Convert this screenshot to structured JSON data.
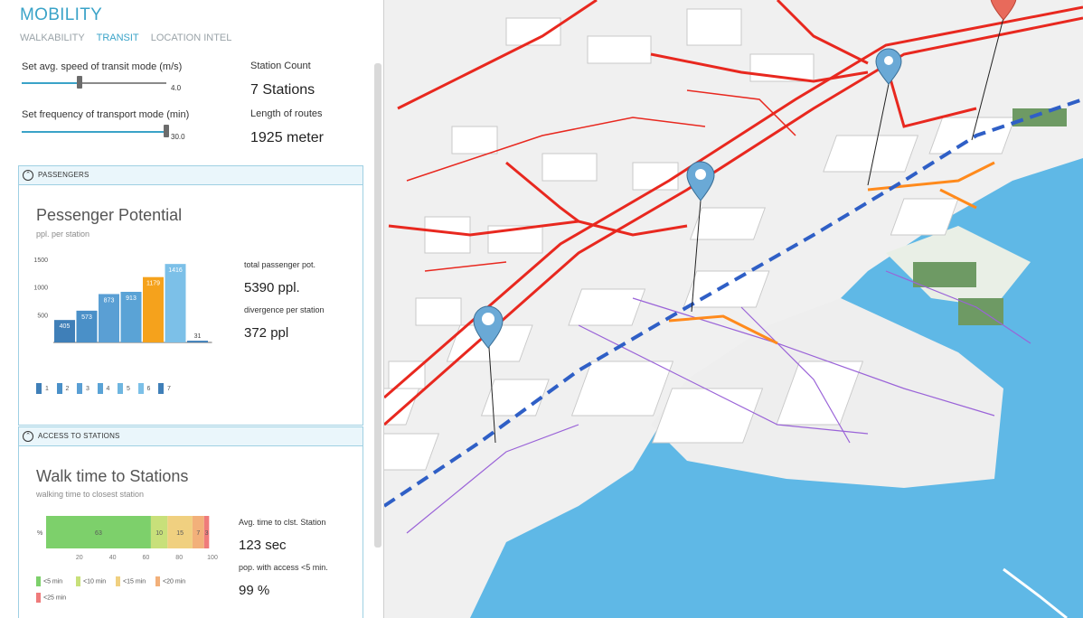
{
  "app": {
    "title": "MOBILITY"
  },
  "tabs": [
    {
      "label": "WALKABILITY",
      "active": false
    },
    {
      "label": "TRANSIT",
      "active": true
    },
    {
      "label": "LOCATION INTEL",
      "active": false
    }
  ],
  "controls": {
    "speed_label": "Set avg. speed of transit mode (m/s)",
    "speed_value": "4.0",
    "speed_fraction": 0.4,
    "frequency_label": "Set frequency of transport mode (min)",
    "frequency_value": "30.0",
    "frequency_fraction": 1.0
  },
  "stats": {
    "station_count_label": "Station Count",
    "station_count_value": "7 Stations",
    "length_label": "Length of routes",
    "length_value": "1925 meter"
  },
  "passengers": {
    "header": "PASSENGERS",
    "title": "Pessenger Potential",
    "subtitle": "ppl. per station",
    "total_label": "total passenger pot.",
    "total_value": "5390 ppl.",
    "divergence_label": "divergence per station",
    "divergence_value": "372 ppl",
    "legend": [
      "1",
      "2",
      "3",
      "4",
      "5",
      "6",
      "7"
    ]
  },
  "access": {
    "header": "ACCESS TO STATIONS",
    "title": "Walk time to Stations",
    "subtitle": "walking time to closest station",
    "avg_label": "Avg. time to clst. Station",
    "avg_value": "123 sec",
    "pop_label": "pop. with access <5 min.",
    "pop_value": "99 %",
    "legend": [
      "<5 min",
      "<10 min",
      "<15 min",
      "<20 min",
      "<25 min"
    ]
  },
  "colors": {
    "accent": "#3aa3c8",
    "bar_highlight": "#f5a21c",
    "bar_blue": "#4a90c8",
    "walk_green": "#7dd06b",
    "walk_lime": "#c8e07a",
    "walk_yellow": "#f0d080",
    "walk_orange": "#f2b07a",
    "walk_red": "#ef7b7b"
  },
  "chart_data": [
    {
      "type": "bar",
      "categories": [
        "1",
        "2",
        "3",
        "4",
        "5",
        "6",
        "7"
      ],
      "values": [
        405,
        573,
        873,
        913,
        1179,
        1416,
        31
      ],
      "highlight_index": 4,
      "ylim": [
        0,
        1500
      ],
      "yticks": [
        "500",
        "1000",
        "1500"
      ],
      "grid": false
    },
    {
      "type": "bar",
      "orientation": "stacked-horizontal",
      "y_label": "%",
      "segments": [
        {
          "label": "<5 min",
          "value": 63
        },
        {
          "label": "<10 min",
          "value": 10
        },
        {
          "label": "<15 min",
          "value": 15
        },
        {
          "label": "<20 min",
          "value": 7
        },
        {
          "label": "<25 min",
          "value": 3
        }
      ],
      "segment_labels": [
        "63",
        "10",
        "15",
        "7",
        "3"
      ],
      "xticks": [
        "20",
        "40",
        "60",
        "80",
        "100"
      ],
      "xlim": [
        0,
        100
      ]
    }
  ]
}
